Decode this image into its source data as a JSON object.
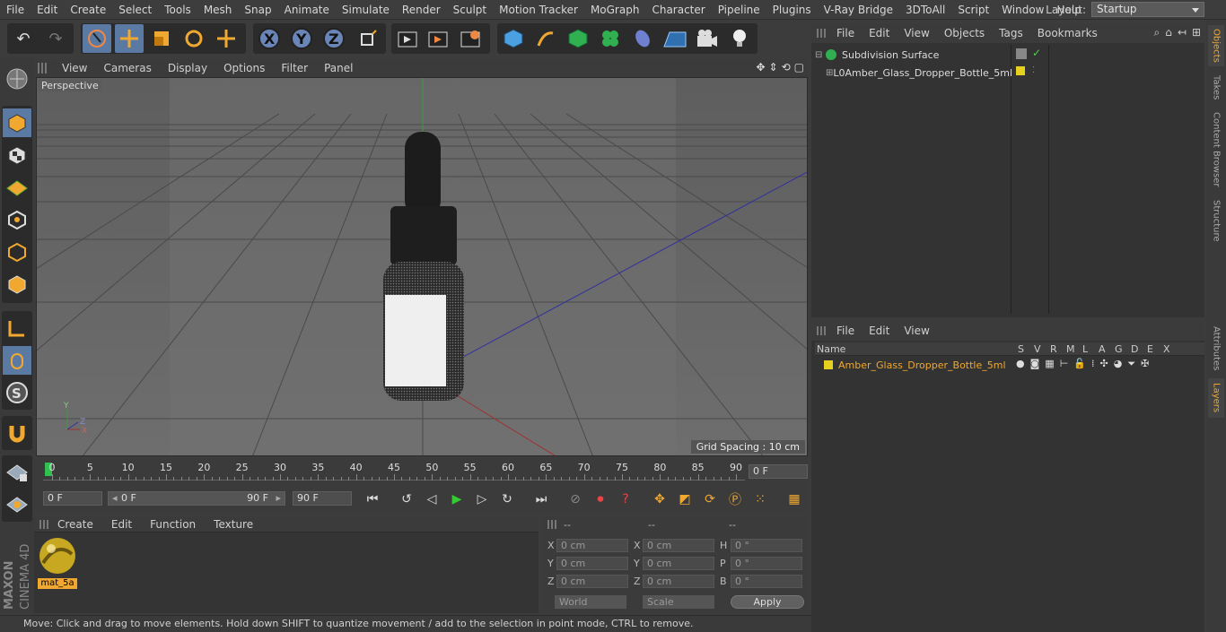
{
  "menubar": {
    "items": [
      "File",
      "Edit",
      "Create",
      "Select",
      "Tools",
      "Mesh",
      "Snap",
      "Animate",
      "Simulate",
      "Render",
      "Sculpt",
      "Motion Tracker",
      "MoGraph",
      "Character",
      "Pipeline",
      "Plugins",
      "V-Ray Bridge",
      "3DToAll",
      "Script",
      "Window",
      "Help"
    ],
    "layout_label": "Layout:",
    "layout_value": "Startup"
  },
  "viewport": {
    "menu": [
      "View",
      "Cameras",
      "Display",
      "Options",
      "Filter",
      "Panel"
    ],
    "label": "Perspective",
    "grid_spacing": "Grid Spacing : 10 cm"
  },
  "timeline": {
    "ticks": [
      "0",
      "5",
      "10",
      "15",
      "20",
      "25",
      "30",
      "35",
      "40",
      "45",
      "50",
      "55",
      "60",
      "65",
      "70",
      "75",
      "80",
      "85",
      "90"
    ],
    "current_frame": "0 F",
    "start_frame": "0 F",
    "range_start": "0 F",
    "range_end": "90 F",
    "end_frame": "90 F"
  },
  "materials": {
    "menu": [
      "Create",
      "Edit",
      "Function",
      "Texture"
    ],
    "items": [
      {
        "name": "mat_5a"
      }
    ]
  },
  "coords": {
    "headers": [
      "--",
      "--",
      "--"
    ],
    "rows": [
      {
        "a": "X",
        "av": "0 cm",
        "b": "X",
        "bv": "0 cm",
        "c": "H",
        "cv": "0 °"
      },
      {
        "a": "Y",
        "av": "0 cm",
        "b": "Y",
        "bv": "0 cm",
        "c": "P",
        "cv": "0 °"
      },
      {
        "a": "Z",
        "av": "0 cm",
        "b": "Z",
        "bv": "0 cm",
        "c": "B",
        "cv": "0 °"
      }
    ],
    "world": "World",
    "scale": "Scale",
    "apply": "Apply"
  },
  "status": "Move: Click and drag to move elements. Hold down SHIFT to quantize movement / add to the selection in point mode, CTRL to remove.",
  "objects": {
    "menu": [
      "File",
      "Edit",
      "View",
      "Objects",
      "Tags",
      "Bookmarks"
    ],
    "tree": [
      {
        "name": "Subdivision Surface"
      },
      {
        "name": "Amber_Glass_Dropper_Bottle_5ml"
      }
    ]
  },
  "layers": {
    "menu": [
      "File",
      "Edit",
      "View"
    ],
    "columns": [
      "Name",
      "S",
      "V",
      "R",
      "M",
      "L",
      "A",
      "G",
      "D",
      "E",
      "X"
    ],
    "rows": [
      {
        "name": "Amber_Glass_Dropper_Bottle_5ml"
      }
    ]
  },
  "right_tabs": [
    "Objects",
    "Takes",
    "Content Browser",
    "Structure",
    "Attributes",
    "Layers"
  ],
  "brand": {
    "line1": "MAXON",
    "line2": "CINEMA 4D"
  },
  "colors": {
    "accent": "#f0a830",
    "layer_yellow": "#e8d020",
    "selection_blue": "#5b7aa3"
  }
}
